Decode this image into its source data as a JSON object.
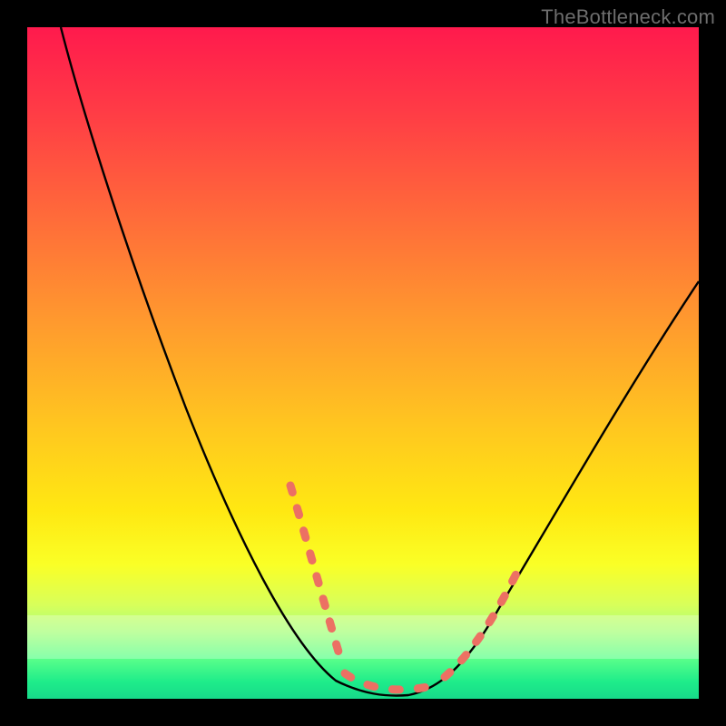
{
  "watermark": {
    "text": "TheBottleneck.com"
  },
  "chart_data": {
    "type": "line",
    "title": "",
    "xlabel": "",
    "ylabel": "",
    "xlim": [
      0,
      100
    ],
    "ylim": [
      0,
      100
    ],
    "grid": false,
    "legend": false,
    "background_gradient_note": "red (top) → orange → yellow → green (bottom), representing worse → better",
    "series": [
      {
        "name": "bottleneck-curve",
        "color": "#000000",
        "x": [
          5,
          10,
          15,
          20,
          25,
          30,
          35,
          40,
          43,
          46,
          49,
          52,
          55,
          58,
          62,
          66,
          70,
          74,
          78,
          82,
          86,
          90,
          94,
          98,
          100
        ],
        "values": [
          100,
          90,
          80,
          70,
          60,
          50,
          40,
          28,
          20,
          11,
          4,
          1,
          0,
          0,
          1,
          4,
          10,
          17,
          24,
          31,
          38,
          45,
          52,
          59,
          62
        ]
      }
    ],
    "dotted_highlight": {
      "note": "Short dotted salmon segments overlaid on the curve near the minimum region",
      "color": "#ec7063",
      "dash": "10 14",
      "segments": [
        {
          "x0": 38,
          "y0": 32,
          "x1": 49,
          "y1": 4
        },
        {
          "x0": 49,
          "y0": 3,
          "x1": 60,
          "y1": 1
        },
        {
          "x0": 62,
          "y0": 2,
          "x1": 72,
          "y1": 14
        }
      ]
    }
  }
}
